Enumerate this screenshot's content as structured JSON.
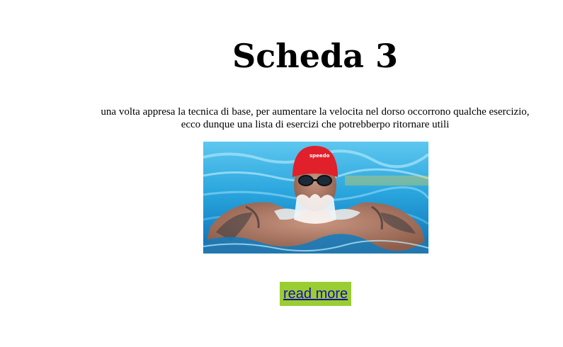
{
  "header": {
    "title": "Scheda 3"
  },
  "content": {
    "intro_line_1": "una volta appresa la tecnica di base, per aumentare la velocita nel dorso occorrono qualche esercizio,",
    "intro_line_2": "ecco dunque una lista di esercizi che potrebberpo ritornare utili"
  },
  "image": {
    "subject": "swimmer-photo",
    "cap_text": "speedo"
  },
  "actions": {
    "read_more_label": "read more"
  },
  "colors": {
    "button_background": "#9acd32",
    "link": "#1a0dab",
    "water": "#1f9fd8",
    "cap": "#e0202a"
  }
}
